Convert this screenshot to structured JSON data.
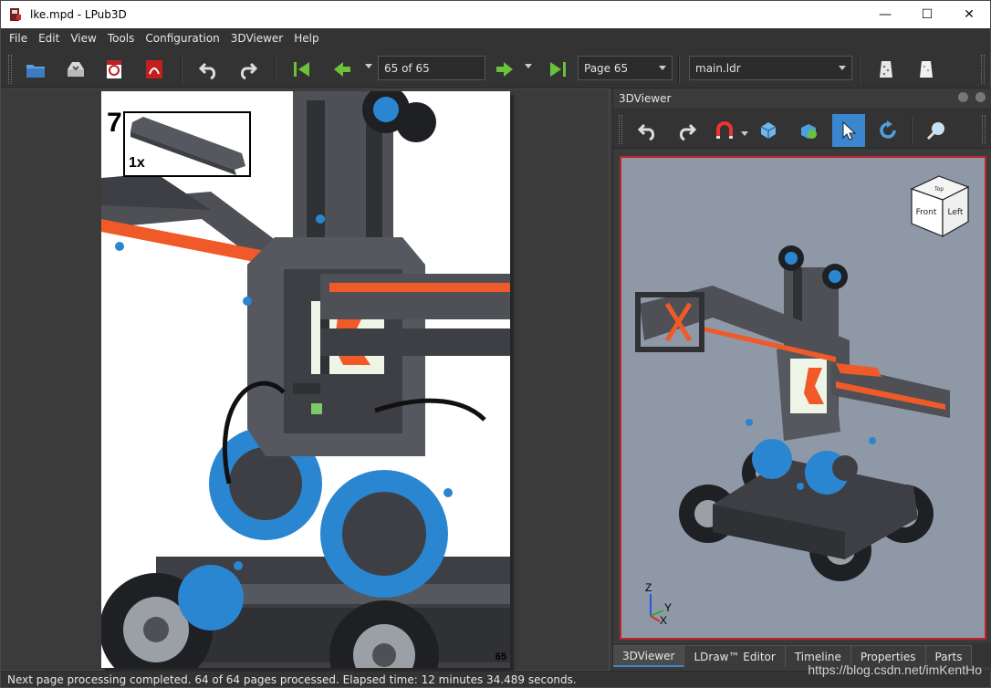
{
  "window": {
    "title": "lke.mpd - LPub3D",
    "minimize_glyph": "—",
    "maximize_glyph": "☐",
    "close_glyph": "✕"
  },
  "menu": {
    "items": [
      "File",
      "Edit",
      "View",
      "Tools",
      "Configuration",
      "3DViewer",
      "Help"
    ]
  },
  "toolbar": {
    "page_field": "65 of 65",
    "page_combo": "Page 65",
    "submodel_combo": "main.ldr",
    "icons": [
      "open-icon",
      "save-icon",
      "export-pdf-icon",
      "acrobat-icon",
      "undo-icon",
      "redo-icon",
      "first-page-icon",
      "previous-page-icon",
      "next-page-icon",
      "last-page-icon",
      "fade-icon",
      "highlight-icon"
    ]
  },
  "page": {
    "step_number": "7",
    "pli_count": "1x",
    "page_number": "65"
  },
  "viewer": {
    "title": "3DViewer",
    "toolbar_icons": [
      "undo-icon",
      "redo-icon",
      "magnet-icon",
      "snap-icon",
      "parts-icon",
      "select-arrow-icon",
      "rotate-icon",
      "zoom-icon"
    ],
    "navcube": {
      "top": "Top",
      "front": "Front",
      "left": "Left"
    },
    "axes": {
      "z": "Z",
      "y": "Y",
      "x": "X"
    }
  },
  "tabs": [
    "3DViewer",
    "LDraw™ Editor",
    "Timeline",
    "Properties",
    "Parts"
  ],
  "status": {
    "message": "Next page processing completed. 64 of 64 pages processed. Elapsed time: 12 minutes 34.489 seconds.",
    "watermark": "https://blog.csdn.net/imKentHo"
  },
  "colors": {
    "accent": "#3a87d0",
    "robot_orange": "#f05a28",
    "robot_blue": "#2b86d1",
    "robot_grey": "#4e5055",
    "viewport_bg": "#8f98a6",
    "viewport_border": "#c0242c"
  }
}
